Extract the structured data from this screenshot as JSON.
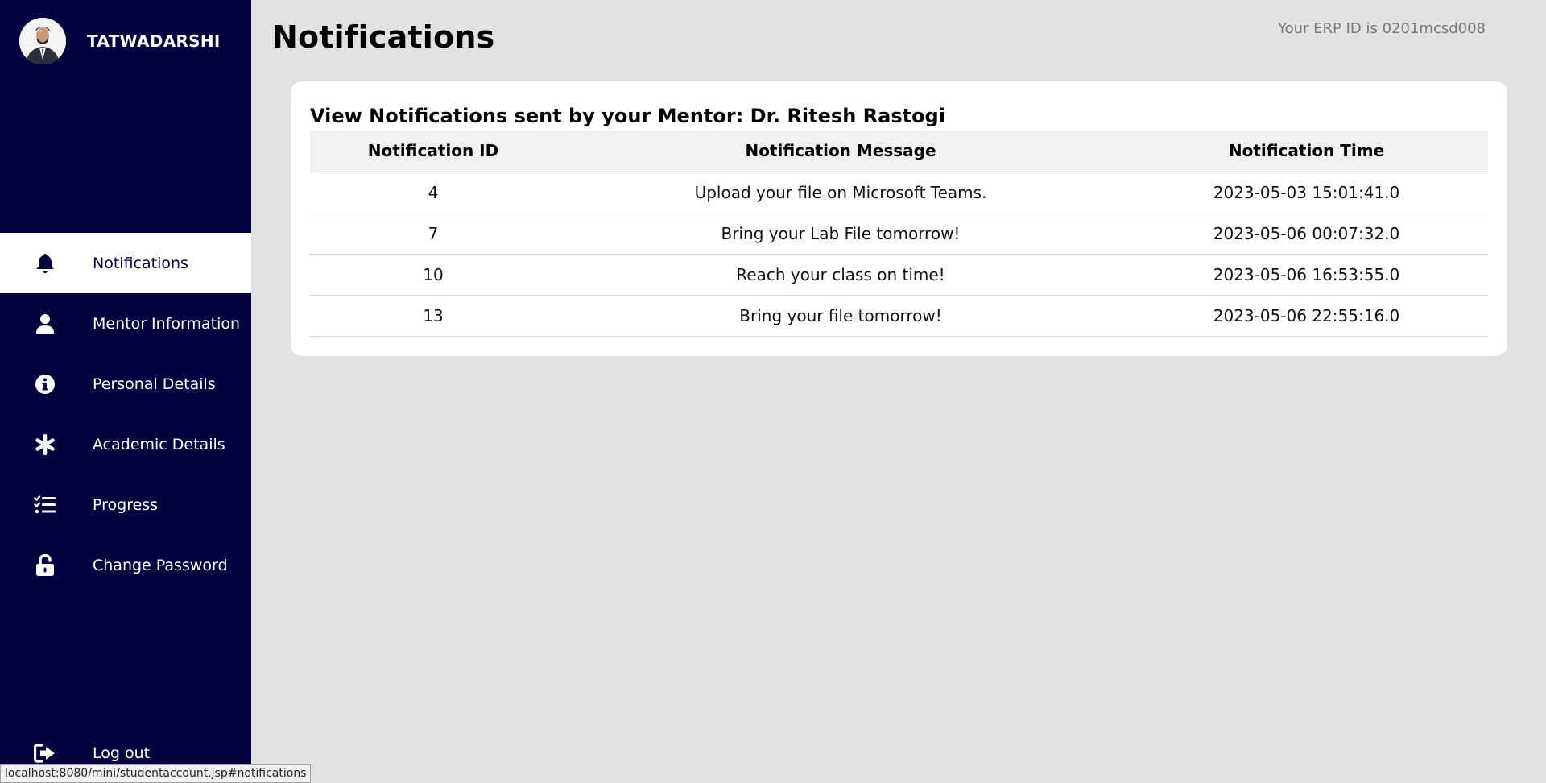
{
  "sidebar": {
    "username": "TATWADARSHI",
    "items": [
      {
        "label": "Notifications",
        "icon": "bell-icon",
        "active": true
      },
      {
        "label": "Mentor Information",
        "icon": "user-icon",
        "active": false
      },
      {
        "label": "Personal Details",
        "icon": "info-icon",
        "active": false
      },
      {
        "label": "Academic Details",
        "icon": "asterisk-icon",
        "active": false
      },
      {
        "label": "Progress",
        "icon": "tasks-list-icon",
        "active": false
      },
      {
        "label": "Change Password",
        "icon": "unlock-icon",
        "active": false
      }
    ],
    "logout_label": "Log out"
  },
  "header": {
    "title": "Notifications",
    "erp_id": "Your ERP ID is 0201mcsd008"
  },
  "card": {
    "heading": "View Notifications sent by your Mentor: Dr. Ritesh Rastogi",
    "columns": [
      "Notification ID",
      "Notification Message",
      "Notification Time"
    ],
    "rows": [
      [
        "4",
        "Upload your file on Microsoft Teams.",
        "2023-05-03 15:01:41.0"
      ],
      [
        "7",
        "Bring your Lab File tomorrow!",
        "2023-05-06 00:07:32.0"
      ],
      [
        "10",
        "Reach your class on time!",
        "2023-05-06 16:53:55.0"
      ],
      [
        "13",
        "Bring your file tomorrow!",
        "2023-05-06 22:55:16.0"
      ]
    ]
  },
  "statusbar": {
    "url": "localhost:8080/mini/studentaccount.jsp#notifications"
  },
  "colors": {
    "sidebar_bg": "#03023f",
    "page_bg": "#e1e1e1",
    "card_bg": "#ffffff",
    "table_header_bg": "#f1f1f1"
  }
}
